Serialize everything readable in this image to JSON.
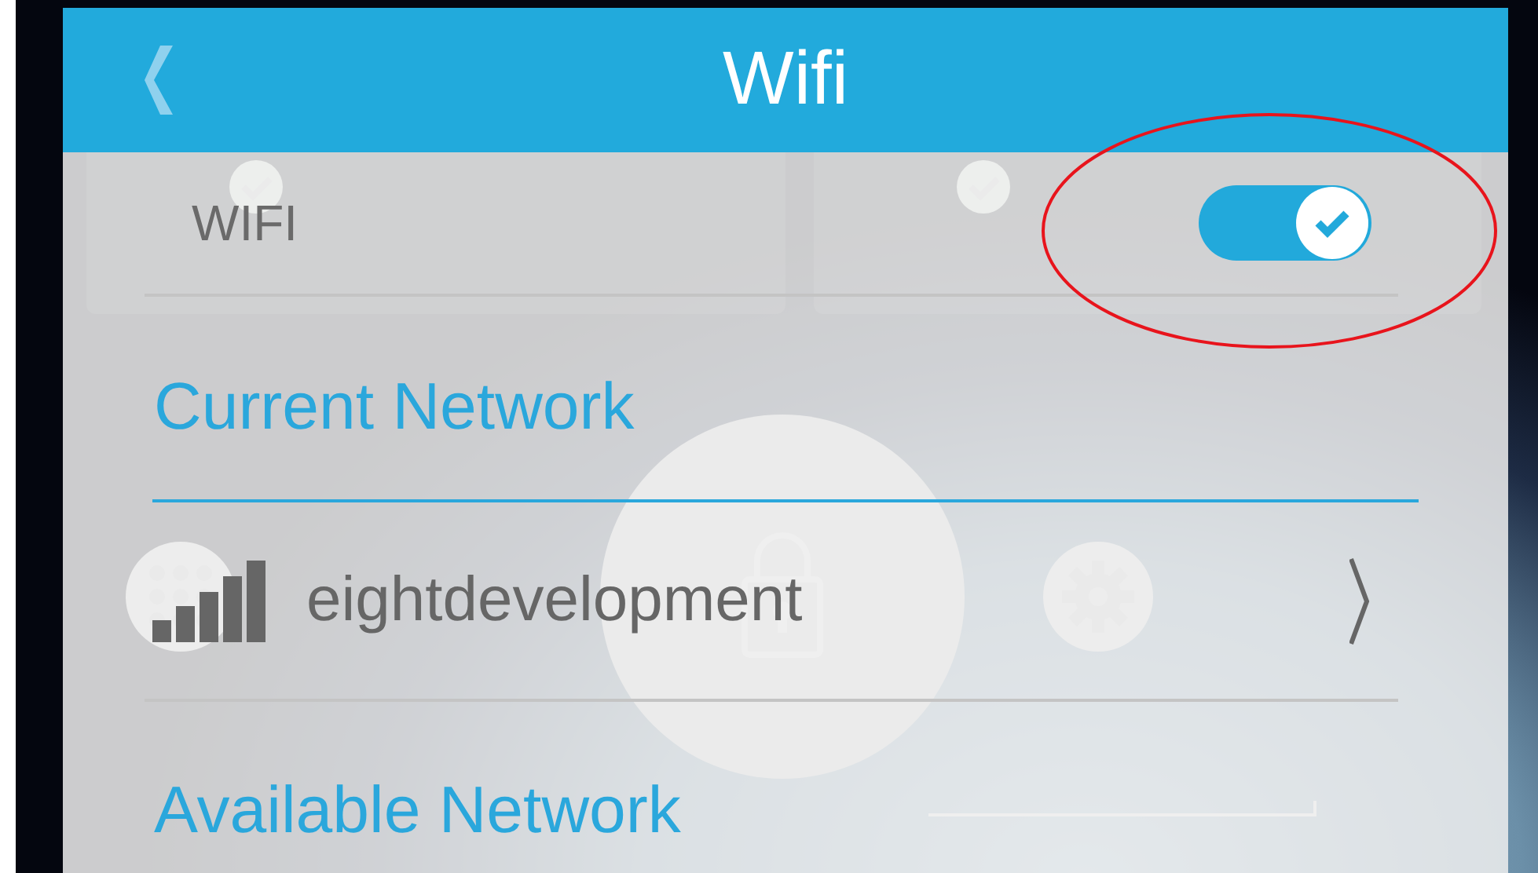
{
  "dialog": {
    "title": "Wifi",
    "wifi": {
      "label": "WIFI",
      "on": true
    },
    "current_heading": "Current Network",
    "current_network": {
      "name": "eightdevelopment"
    },
    "available_heading": "Available Network"
  }
}
